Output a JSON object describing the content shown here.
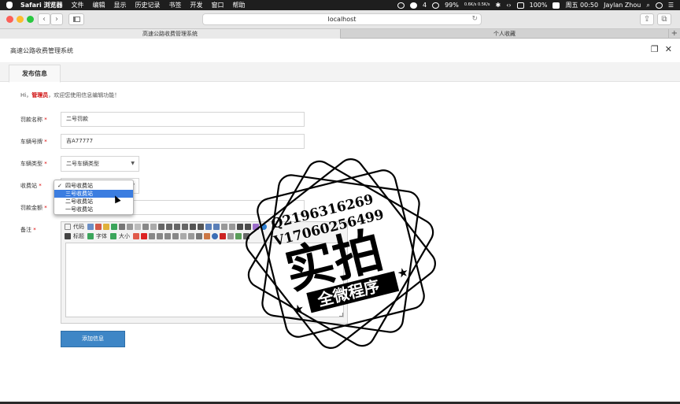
{
  "menubar": {
    "app_name": "Safari 浏览器",
    "items": [
      "文件",
      "编辑",
      "显示",
      "历史记录",
      "书签",
      "开发",
      "窗口",
      "帮助"
    ],
    "status": {
      "battery_small": "4",
      "network": "0.6K/s 0.5K/s",
      "battery_percent": "99%",
      "battery_main": "100%",
      "clock": "周五 00:50",
      "user": "Jaylan Zhou"
    }
  },
  "browser": {
    "url": "localhost",
    "tabs": [
      {
        "label": "高速公路收费管理系统",
        "active": true
      },
      {
        "label": "个人收藏",
        "active": false
      }
    ]
  },
  "app": {
    "title": "高速公路收费管理系统",
    "tab_label": "发布信息",
    "welcome_prefix": "Hi，",
    "welcome_user": "管理员",
    "welcome_suffix": "，欢迎您使用信息编辑功能！"
  },
  "form": {
    "fine_name_label": "罚款名称",
    "fine_name_value": "二号罚款",
    "plate_label": "车辆号牌",
    "plate_value": "吉A77777",
    "vehicle_type_label": "车辆类型",
    "vehicle_type_value": "二号车辆类型",
    "station_label": "收费站",
    "amount_label": "罚款金额",
    "note_label": "备注",
    "required_mark": "*",
    "submit_label": "添加信息"
  },
  "dropdown": {
    "options": [
      "四号收费站",
      "三号收费站",
      "二号收费站",
      "一号收费站"
    ],
    "checked_index": 0,
    "highlighted_index": 1,
    "check_mark": "✓"
  },
  "editor": {
    "code_label": "代码",
    "heading_label": "标题",
    "font_label": "字体",
    "size_label": "大小"
  },
  "watermark": {
    "line1": "Q2196316269",
    "line2": "V17060256499",
    "main": "实拍",
    "banner": "全微程序"
  },
  "colors": {
    "accent_button": "#3e86c6",
    "admin_text": "#cc0000",
    "highlight": "#3b7de0"
  }
}
